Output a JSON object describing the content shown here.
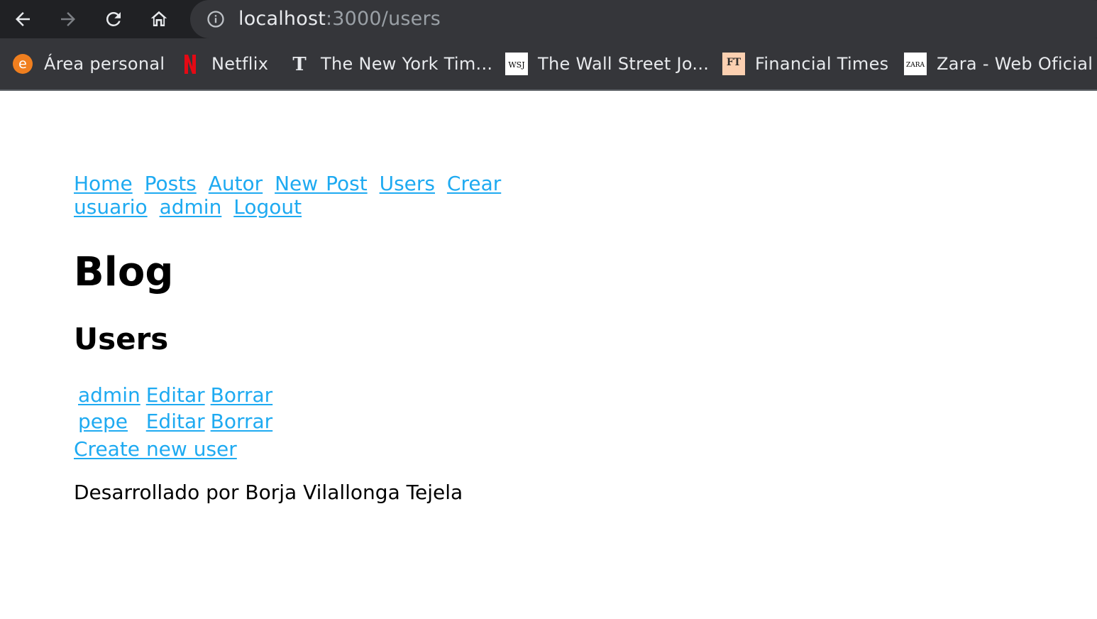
{
  "browser": {
    "url_host": "localhost",
    "url_path": ":3000/users",
    "bookmarks": [
      {
        "label": "Área personal",
        "icon": "e-circle-icon"
      },
      {
        "label": "Netflix",
        "icon": "netflix-icon"
      },
      {
        "label": "The New York Tim...",
        "icon": "nyt-icon"
      },
      {
        "label": "The Wall Street Jo...",
        "icon": "wsj-icon"
      },
      {
        "label": "Financial Times",
        "icon": "ft-icon"
      },
      {
        "label": "Zara - Web Oficial",
        "icon": "zara-icon"
      }
    ],
    "favicon_texts": {
      "e": "e",
      "netflix": "N",
      "nyt": "𝕿",
      "wsj": "WSJ",
      "ft": "FT",
      "zara": "ZARA"
    }
  },
  "nav": {
    "links": [
      "Home",
      "Posts",
      "Autor",
      "New Post",
      "Users",
      "Crear usuario",
      "admin",
      "Logout"
    ]
  },
  "page": {
    "title": "Blog",
    "subtitle": "Users"
  },
  "users": [
    {
      "name": "admin",
      "edit": "Editar",
      "delete": "Borrar"
    },
    {
      "name": "pepe",
      "edit": "Editar",
      "delete": "Borrar"
    }
  ],
  "create_link": "Create new user",
  "footer": "Desarrollado por Borja Vilallonga Tejela",
  "colors": {
    "link": "#1eaaf1",
    "toolbar_bg": "#202124",
    "bookmarks_bg": "#35363a"
  }
}
